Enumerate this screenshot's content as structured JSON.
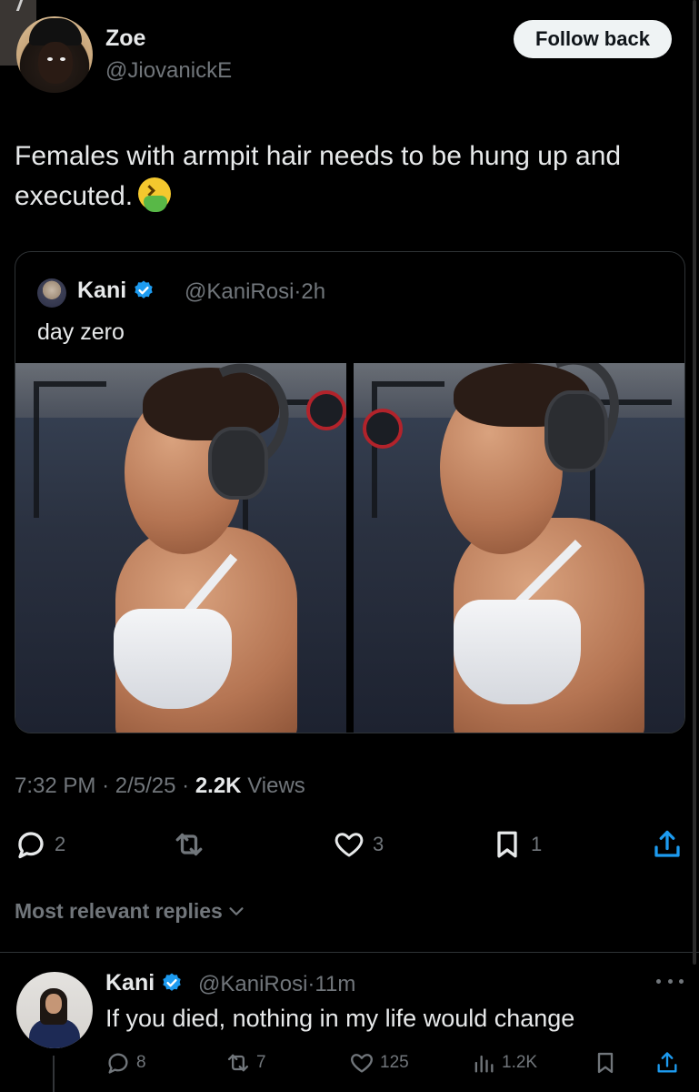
{
  "tweet": {
    "author_name": "Zoe",
    "author_handle": "@JiovanickE",
    "follow_label": "Follow back",
    "text": "Females with armpit hair needs to be hung up and executed.",
    "timestamp_time": "7:32 PM",
    "timestamp_sep": "·",
    "timestamp_date": "2/5/25",
    "views_count": "2.2K",
    "views_label": "Views",
    "actions": {
      "replies": "2",
      "reposts": "",
      "likes": "3",
      "bookmarks": "1"
    }
  },
  "quote": {
    "author_name": "Kani",
    "author_handle": "@KaniRosi",
    "time": "2h",
    "text": "day zero"
  },
  "replies_filter": {
    "label": "Most relevant replies"
  },
  "reply": {
    "author_name": "Kani",
    "author_handle": "@KaniRosi",
    "time": "11m",
    "text": "If you died, nothing in my life would change",
    "actions": {
      "replies": "8",
      "reposts": "7",
      "likes": "125",
      "views": "1.2K"
    }
  },
  "colors": {
    "background": "#000000",
    "text_primary": "#e7e9ea",
    "text_secondary": "#71767b",
    "verified": "#1d9bf0",
    "border": "#2f3336"
  }
}
